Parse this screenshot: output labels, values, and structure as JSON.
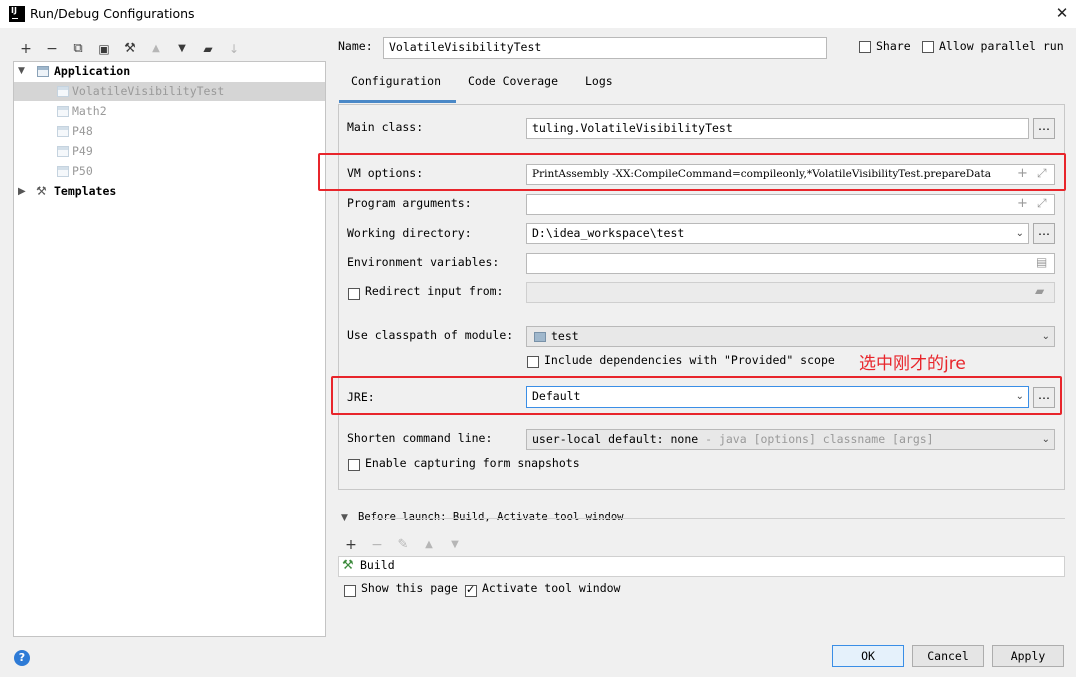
{
  "window": {
    "title": "Run/Debug Configurations",
    "close_glyph": "✕"
  },
  "toolbar": [
    {
      "name": "add-icon",
      "glyph": "+"
    },
    {
      "name": "remove-icon",
      "glyph": "−"
    },
    {
      "name": "copy-icon",
      "glyph": "⧉"
    },
    {
      "name": "save-icon",
      "glyph": "🖫"
    },
    {
      "name": "wrench-icon",
      "glyph": "🔧"
    },
    {
      "name": "move-up-icon",
      "glyph": "▲"
    },
    {
      "name": "move-down-icon",
      "glyph": "▼"
    },
    {
      "name": "folder-icon",
      "glyph": "📁"
    },
    {
      "name": "sort-icon",
      "glyph": "↓"
    }
  ],
  "tree": {
    "root": "Application",
    "items": [
      "VolatileVisibilityTest",
      "Math2",
      "P48",
      "P49",
      "P50"
    ],
    "templates": "Templates"
  },
  "header": {
    "name_label": "Name:",
    "name_value": "VolatileVisibilityTest",
    "share_label": "Share",
    "parallel_label": "Allow parallel run"
  },
  "tabs": [
    "Configuration",
    "Code Coverage",
    "Logs"
  ],
  "form": {
    "main_class_label": "Main class:",
    "main_class_value": "tuling.VolatileVisibilityTest",
    "vm_options_label": "VM options:",
    "vm_options_value": "PrintAssembly -XX:CompileCommand=compileonly,*VolatileVisibilityTest.prepareData",
    "program_args_label": "Program arguments:",
    "program_args_value": "",
    "working_dir_label": "Working directory:",
    "working_dir_value": "D:\\idea_workspace\\test",
    "env_vars_label": "Environment variables:",
    "env_vars_value": "",
    "redirect_label": "Redirect input from:",
    "classpath_label": "Use classpath of module:",
    "classpath_value": "test",
    "include_deps_label": "Include dependencies with \"Provided\" scope",
    "jre_label": "JRE:",
    "jre_value": "Default",
    "shorten_label": "Shorten command line:",
    "shorten_value": "user-local default: none",
    "shorten_hint": "- java [options] classname [args]",
    "capture_label": "Enable capturing form snapshots"
  },
  "annotation": "选中刚才的jre",
  "before_launch": {
    "label": "Before launch: Build, Activate tool window",
    "item": "Build",
    "show_page_label": "Show this page",
    "activate_label": "Activate tool window"
  },
  "buttons": {
    "ok": "OK",
    "cancel": "Cancel",
    "apply": "Apply"
  },
  "colors": {
    "accent": "#3a8ee6",
    "annotation_red": "#e8252b",
    "tab_underline": "#4a88c7"
  }
}
